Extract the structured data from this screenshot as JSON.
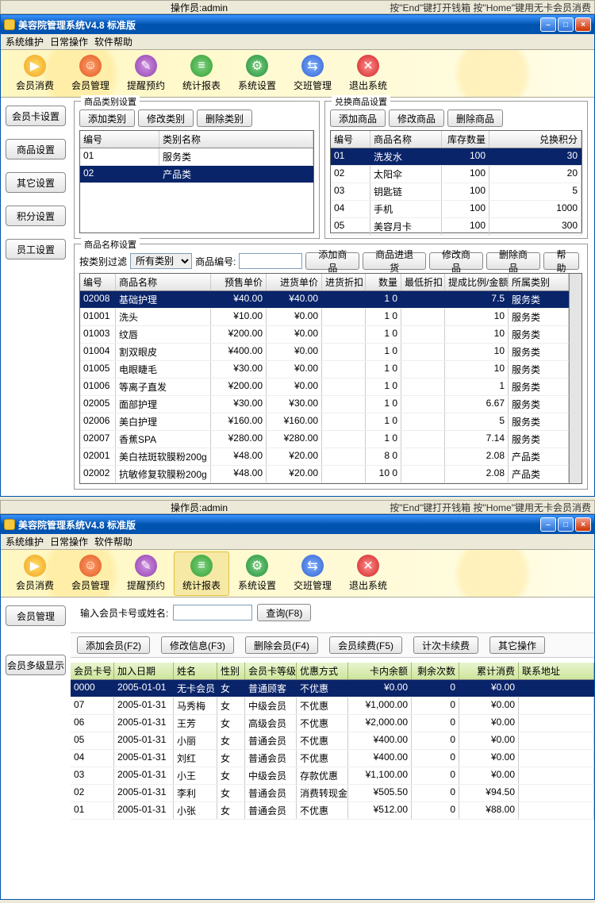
{
  "status_top": {
    "operator_label": "操作员:admin",
    "right_hint": "按\"End\"键打开钱箱  按\"Home\"键用无卡会员消费"
  },
  "window_title": "美容院管理系统V4.8 标准版",
  "menu": {
    "m1": "系统维护",
    "m2": "日常操作",
    "m3": "软件帮助"
  },
  "toolbar": {
    "consume": "会员消费",
    "manage": "会员管理",
    "remind": "提醒预约",
    "stats": "统计报表",
    "system": "系统设置",
    "shift": "交班管理",
    "exit": "退出系统"
  },
  "sidebar_a": [
    "会员卡设置",
    "商品设置",
    "其它设置",
    "积分设置",
    "员工设置"
  ],
  "cat_panel": {
    "title": "商品类别设置",
    "btns": [
      "添加类别",
      "修改类别",
      "删除类别"
    ],
    "cols": [
      "编号",
      "类别名称"
    ],
    "rows": [
      {
        "id": "01",
        "name": "服务类",
        "sel": false
      },
      {
        "id": "02",
        "name": "产品类",
        "sel": true
      }
    ]
  },
  "exchange_panel": {
    "title": "兑换商品设置",
    "btns": [
      "添加商品",
      "修改商品",
      "删除商品"
    ],
    "cols": [
      "编号",
      "商品名称",
      "库存数量",
      "兑换积分"
    ],
    "rows": [
      {
        "id": "01",
        "name": "洗发水",
        "stock": "100",
        "pts": "30",
        "sel": true
      },
      {
        "id": "02",
        "name": "太阳伞",
        "stock": "100",
        "pts": "20",
        "sel": false
      },
      {
        "id": "03",
        "name": "钥匙链",
        "stock": "100",
        "pts": "5",
        "sel": false
      },
      {
        "id": "04",
        "name": "手机",
        "stock": "100",
        "pts": "1000",
        "sel": false
      },
      {
        "id": "05",
        "name": "美容月卡",
        "stock": "100",
        "pts": "300",
        "sel": false
      }
    ]
  },
  "name_panel": {
    "title": "商品名称设置",
    "filter_label": "按类别过滤",
    "filter_sel": "所有类别",
    "code_label": "商品编号:",
    "btns": [
      "添加商品",
      "商品进退货",
      "修改商品",
      "删除商品",
      "帮助"
    ],
    "cols": [
      "编号",
      "商品名称",
      "预售单价",
      "进货单价",
      "进货折扣",
      "数量",
      "最低折扣",
      "提成比例/金额",
      "所属类别"
    ],
    "rows": [
      {
        "id": "02008",
        "name": "基础护理",
        "sale": "¥40.00",
        "buy": "¥40.00",
        "disc": "",
        "qty": "1 0",
        "mind": "",
        "comm": "7.5",
        "cat": "服务类",
        "sel": true
      },
      {
        "id": "01001",
        "name": "洗头",
        "sale": "¥10.00",
        "buy": "¥0.00",
        "disc": "",
        "qty": "1 0",
        "mind": "",
        "comm": "10",
        "cat": "服务类",
        "sel": false
      },
      {
        "id": "01003",
        "name": "纹唇",
        "sale": "¥200.00",
        "buy": "¥0.00",
        "disc": "",
        "qty": "1 0",
        "mind": "",
        "comm": "10",
        "cat": "服务类",
        "sel": false
      },
      {
        "id": "01004",
        "name": "割双眼皮",
        "sale": "¥400.00",
        "buy": "¥0.00",
        "disc": "",
        "qty": "1 0",
        "mind": "",
        "comm": "10",
        "cat": "服务类",
        "sel": false
      },
      {
        "id": "01005",
        "name": "电眼睫毛",
        "sale": "¥30.00",
        "buy": "¥0.00",
        "disc": "",
        "qty": "1 0",
        "mind": "",
        "comm": "10",
        "cat": "服务类",
        "sel": false
      },
      {
        "id": "01006",
        "name": "等离子直发",
        "sale": "¥200.00",
        "buy": "¥0.00",
        "disc": "",
        "qty": "1 0",
        "mind": "",
        "comm": "1",
        "cat": "服务类",
        "sel": false
      },
      {
        "id": "02005",
        "name": "面部护理",
        "sale": "¥30.00",
        "buy": "¥30.00",
        "disc": "",
        "qty": "1 0",
        "mind": "",
        "comm": "6.67",
        "cat": "服务类",
        "sel": false
      },
      {
        "id": "02006",
        "name": "美白护理",
        "sale": "¥160.00",
        "buy": "¥160.00",
        "disc": "",
        "qty": "1 0",
        "mind": "",
        "comm": "5",
        "cat": "服务类",
        "sel": false
      },
      {
        "id": "02007",
        "name": "香蕉SPA",
        "sale": "¥280.00",
        "buy": "¥280.00",
        "disc": "",
        "qty": "1 0",
        "mind": "",
        "comm": "7.14",
        "cat": "服务类",
        "sel": false
      },
      {
        "id": "02001",
        "name": "美白祛斑软膜粉200g",
        "sale": "¥48.00",
        "buy": "¥20.00",
        "disc": "",
        "qty": "8 0",
        "mind": "",
        "comm": "2.08",
        "cat": "产品类",
        "sel": false
      },
      {
        "id": "02002",
        "name": "抗敏修复软膜粉200g",
        "sale": "¥48.00",
        "buy": "¥20.00",
        "disc": "",
        "qty": "10 0",
        "mind": "",
        "comm": "2.08",
        "cat": "产品类",
        "sel": false
      }
    ]
  },
  "window2": {
    "search_label": "输入会员卡号或姓名:",
    "search_btn": "查询(F8)",
    "sidebar": [
      "会员管理",
      "会员多级显示"
    ],
    "actions": [
      "添加会员(F2)",
      "修改信息(F3)",
      "删除会员(F4)",
      "会员续费(F5)",
      "计次卡续费",
      "其它操作"
    ],
    "cols": [
      "会员卡号",
      "加入日期",
      "姓名",
      "性别",
      "会员卡等级",
      "优惠方式",
      "卡内余额",
      "剩余次数",
      "累计消费",
      "联系地址"
    ],
    "rows": [
      {
        "card": "0000",
        "date": "2005-01-01",
        "name": "无卡会员",
        "sex": "女",
        "level": "普通顾客",
        "disc": "不优惠",
        "bal": "¥0.00",
        "rem": "0",
        "spent": "¥0.00",
        "addr": "",
        "sel": true
      },
      {
        "card": "07",
        "date": "2005-01-31",
        "name": "马秀梅",
        "sex": "女",
        "level": "中级会员",
        "disc": "不优惠",
        "bal": "¥1,000.00",
        "rem": "0",
        "spent": "¥0.00",
        "addr": "",
        "sel": false
      },
      {
        "card": "06",
        "date": "2005-01-31",
        "name": "王芳",
        "sex": "女",
        "level": "高级会员",
        "disc": "不优惠",
        "bal": "¥2,000.00",
        "rem": "0",
        "spent": "¥0.00",
        "addr": "",
        "sel": false
      },
      {
        "card": "05",
        "date": "2005-01-31",
        "name": "小丽",
        "sex": "女",
        "level": "普通会员",
        "disc": "不优惠",
        "bal": "¥400.00",
        "rem": "0",
        "spent": "¥0.00",
        "addr": "",
        "sel": false
      },
      {
        "card": "04",
        "date": "2005-01-31",
        "name": "刘红",
        "sex": "女",
        "level": "普通会员",
        "disc": "不优惠",
        "bal": "¥400.00",
        "rem": "0",
        "spent": "¥0.00",
        "addr": "",
        "sel": false
      },
      {
        "card": "03",
        "date": "2005-01-31",
        "name": "小王",
        "sex": "女",
        "level": "中级会员",
        "disc": "存款优惠",
        "bal": "¥1,100.00",
        "rem": "0",
        "spent": "¥0.00",
        "addr": "",
        "sel": false
      },
      {
        "card": "02",
        "date": "2005-01-31",
        "name": "李利",
        "sex": "女",
        "level": "普通会员",
        "disc": "消费转现金",
        "bal": "¥505.50",
        "rem": "0",
        "spent": "¥94.50",
        "addr": "",
        "sel": false
      },
      {
        "card": "01",
        "date": "2005-01-31",
        "name": "小张",
        "sex": "女",
        "level": "普通会员",
        "disc": "不优惠",
        "bal": "¥512.00",
        "rem": "0",
        "spent": "¥88.00",
        "addr": "",
        "sel": false
      }
    ]
  }
}
